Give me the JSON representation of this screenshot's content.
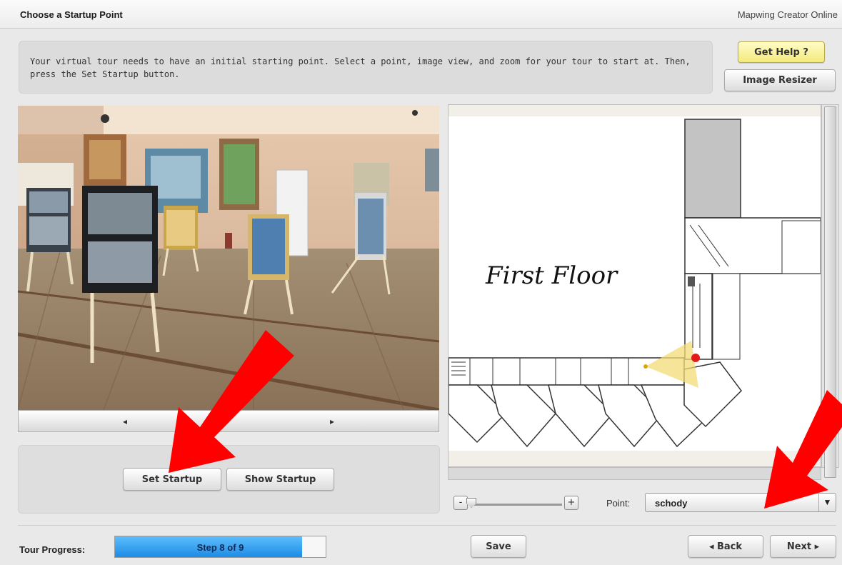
{
  "header": {
    "title": "Choose a Startup Point",
    "app_name": "Mapwing Creator Online"
  },
  "instructions": {
    "text": "Your virtual tour needs to have an initial starting point. Select a point, image view, and zoom for your tour to start at. Then, press the Set Startup button."
  },
  "buttons": {
    "get_help": "Get Help ?",
    "image_resizer": "Image Resizer",
    "set_startup": "Set Startup",
    "show_startup": "Show Startup",
    "save": "Save",
    "back": "◂ Back",
    "next": "Next ▸"
  },
  "photo_nav": {
    "prev_icon": "◂",
    "next_icon": "▸"
  },
  "map": {
    "floor_label": "First Floor"
  },
  "zoom": {
    "minus": "-",
    "plus": "+",
    "level": 0.02
  },
  "point": {
    "label": "Point:",
    "selected": "schody",
    "caret": "▼"
  },
  "progress": {
    "label": "Tour Progress:",
    "text": "Step 8 of 9",
    "fraction": 0.889
  },
  "colors": {
    "accent_blue": "#1d8ce6",
    "help_yellow": "#f3ea7b",
    "annotation_red": "#ff0000"
  }
}
